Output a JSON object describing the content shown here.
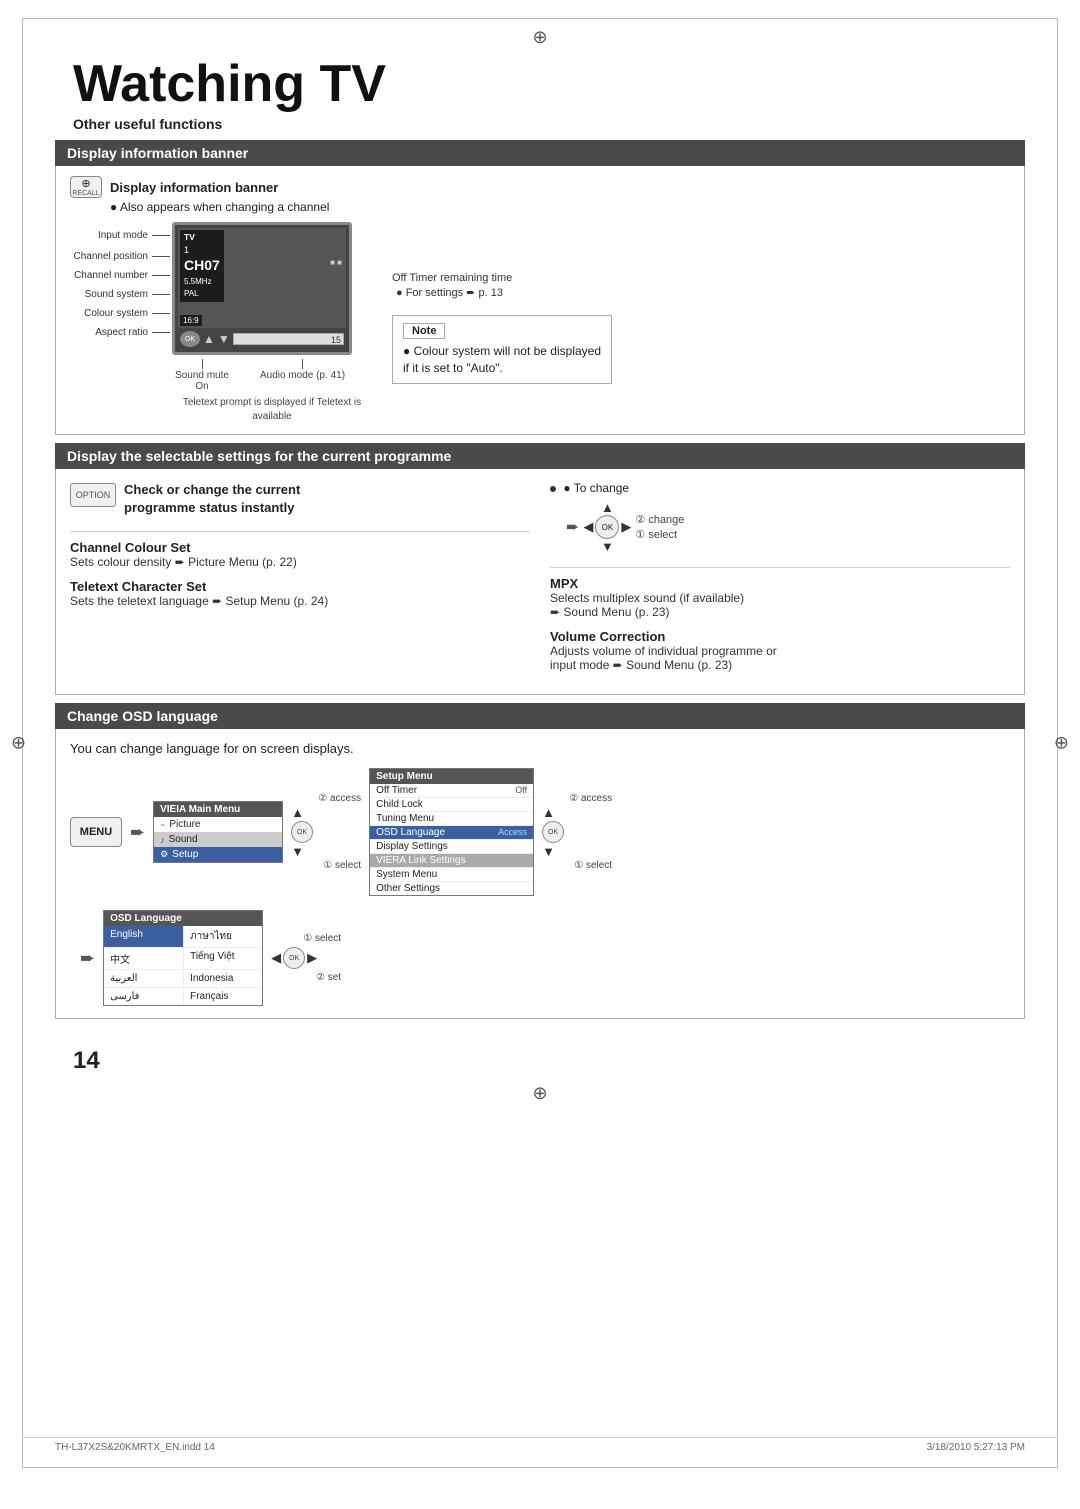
{
  "page": {
    "title": "Watching TV",
    "page_number": "14",
    "footer_left": "TH-L37X2S&20KMRTX_EN.indd  14",
    "footer_right": "3/18/2010  5:27:13 PM",
    "crosshair_top": "⊕",
    "crosshair_left": "⊕",
    "crosshair_right": "⊕",
    "crosshair_bottom": "⊕"
  },
  "other_useful_functions": {
    "label": "Other useful functions"
  },
  "section1": {
    "title": "Display information banner",
    "recall_label": "RECALL",
    "header_bold": "Display information banner",
    "also_appears": "● Also appears when changing a channel",
    "labels": [
      "Input mode",
      "Channel position",
      "Channel number",
      "Sound system",
      "Colour system",
      "Aspect ratio"
    ],
    "values": [
      "TV",
      "1",
      "CH07",
      "5.5MHz",
      "PAL",
      "16:9"
    ],
    "audio_mode": "Audio mode (p. 41)",
    "sound_mute_on": "Sound mute On",
    "off_timer_label": "Off Timer remaining time",
    "off_timer_note": "● For settings ➨ p. 13",
    "teletext_note": "Teletext prompt is displayed if\nTeletext is available",
    "progress_num": "15",
    "note_box_title": "Note",
    "note_bullet": "● Colour system will not be displayed if it is set to \"Auto\"."
  },
  "section2": {
    "title": "Display the selectable settings for the current programme",
    "option_label": "OPTION",
    "check_text_line1": "Check or change the current",
    "check_text_line2": "programme status instantly",
    "to_change": "● To change",
    "change_label": "② change",
    "select_label": "① select",
    "channel_colour_set_title": "Channel Colour Set",
    "channel_colour_set_desc": "Sets colour density ➨ Picture Menu (p. 22)",
    "teletext_char_title": "Teletext Character Set",
    "teletext_char_desc": "Sets the teletext language ➨ Setup Menu (p. 24)",
    "mpx_title": "MPX",
    "mpx_desc_line1": "Selects multiplex sound (if available)",
    "mpx_desc_line2": "➨ Sound Menu (p. 23)",
    "volume_correction_title": "Volume Correction",
    "volume_correction_desc_line1": "Adjusts volume of individual programme or",
    "volume_correction_desc_line2": "input mode ➨ Sound Menu (p. 23)"
  },
  "section3": {
    "title": "Change OSD language",
    "intro": "You can change language for on screen displays.",
    "menu_label": "MENU",
    "viera_menu_title": "VIEIA Main Menu",
    "viera_items": [
      {
        "label": "Picture",
        "icon": "~"
      },
      {
        "label": "Sound",
        "icon": "♪"
      },
      {
        "label": "Setup",
        "icon": "⚙"
      }
    ],
    "access_label_2": "② access",
    "select_label_1": "① select",
    "setup_menu_title": "Setup Menu",
    "setup_items": [
      {
        "label": "Off Timer",
        "value": "Off"
      },
      {
        "label": "Child Lock",
        "value": ""
      },
      {
        "label": "Tuning Menu",
        "value": ""
      },
      {
        "label": "OSD Language",
        "value": "Access",
        "highlight": true
      },
      {
        "label": "Display Settings",
        "value": ""
      },
      {
        "label": "VIERA Link Settings",
        "value": ""
      },
      {
        "label": "System Menu",
        "value": ""
      },
      {
        "label": "Other Settings",
        "value": ""
      }
    ],
    "access_label_2b": "② access",
    "select_label_1b": "① select",
    "osd_lang_title": "OSD Language",
    "osd_languages": [
      {
        "label": "English",
        "selected": true
      },
      {
        "label": "ภาษาไทย",
        "selected": false
      },
      {
        "label": "中文",
        "selected": false
      },
      {
        "label": "Tiếng Việt",
        "selected": false
      },
      {
        "label": "العربية",
        "selected": false
      },
      {
        "label": "Indonesia",
        "selected": false
      },
      {
        "label": "فارسى",
        "selected": false
      },
      {
        "label": "Français",
        "selected": false
      }
    ],
    "select_label_1c": "① select",
    "set_label_2": "② set"
  }
}
